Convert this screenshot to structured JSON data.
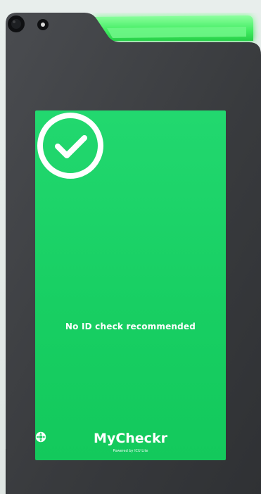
{
  "device": {
    "status_message": "No ID check recommended",
    "brand": {
      "name": "MyCheckr",
      "tagline": "Powered by ICU Lite"
    },
    "colors": {
      "screen_green": "#18cf63",
      "glow_green": "#39ff6f",
      "body_dark": "#3b3d40"
    },
    "icons": [
      "camera-lens-icon",
      "sensor-icon",
      "checkmark-circle-icon",
      "mycheckr-logo-icon"
    ]
  }
}
